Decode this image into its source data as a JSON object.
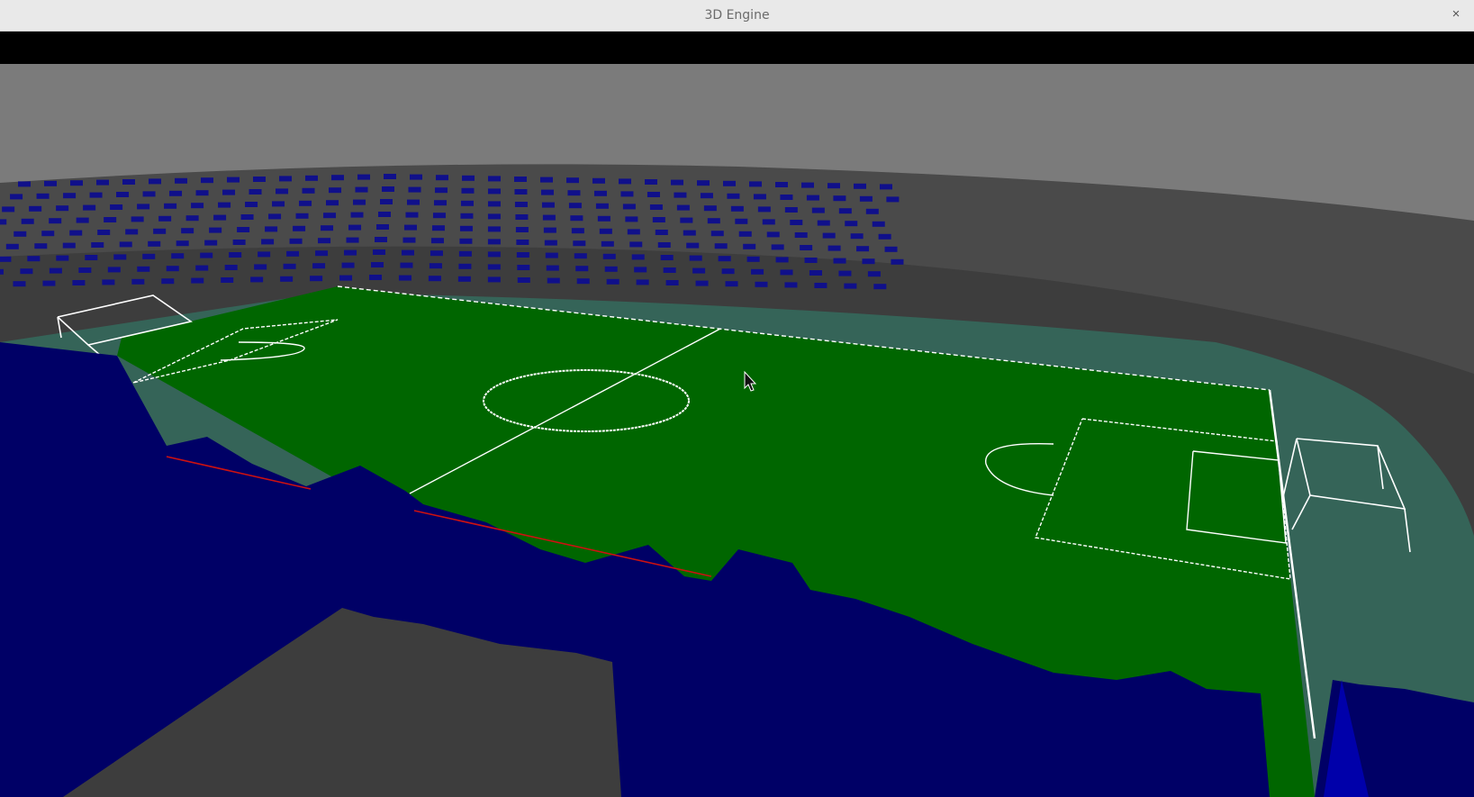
{
  "window": {
    "title": "3D Engine",
    "close_glyph": "×"
  },
  "scene": {
    "sky_color": "#7a7a7a",
    "upper_stand_color": "#4a4a4a",
    "lower_stand_color": "#3a3a3a",
    "pitch_color": "#006600",
    "track_color": "#356458",
    "seat_color": "#10108a",
    "foreground_color": "#000066",
    "line_color": "#ffffff",
    "red_line_color": "#cc1111",
    "cursor_icon": "arrow-cursor-icon"
  }
}
